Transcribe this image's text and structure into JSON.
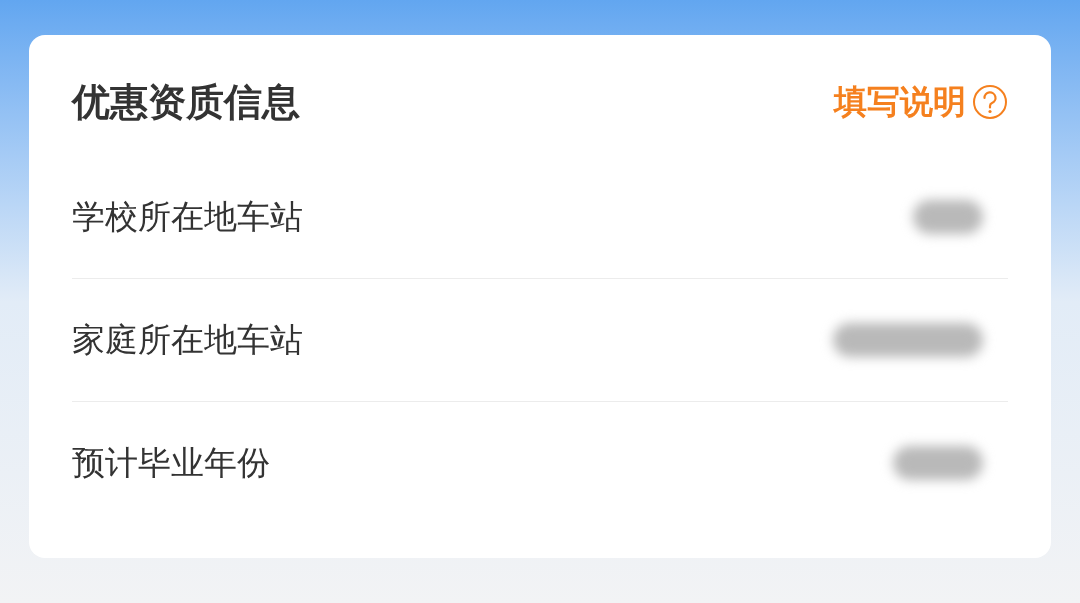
{
  "card": {
    "title": "优惠资质信息",
    "help_link": "填写说明",
    "rows": [
      {
        "label": "学校所在地车站"
      },
      {
        "label": "家庭所在地车站"
      },
      {
        "label": "预计毕业年份"
      }
    ]
  }
}
